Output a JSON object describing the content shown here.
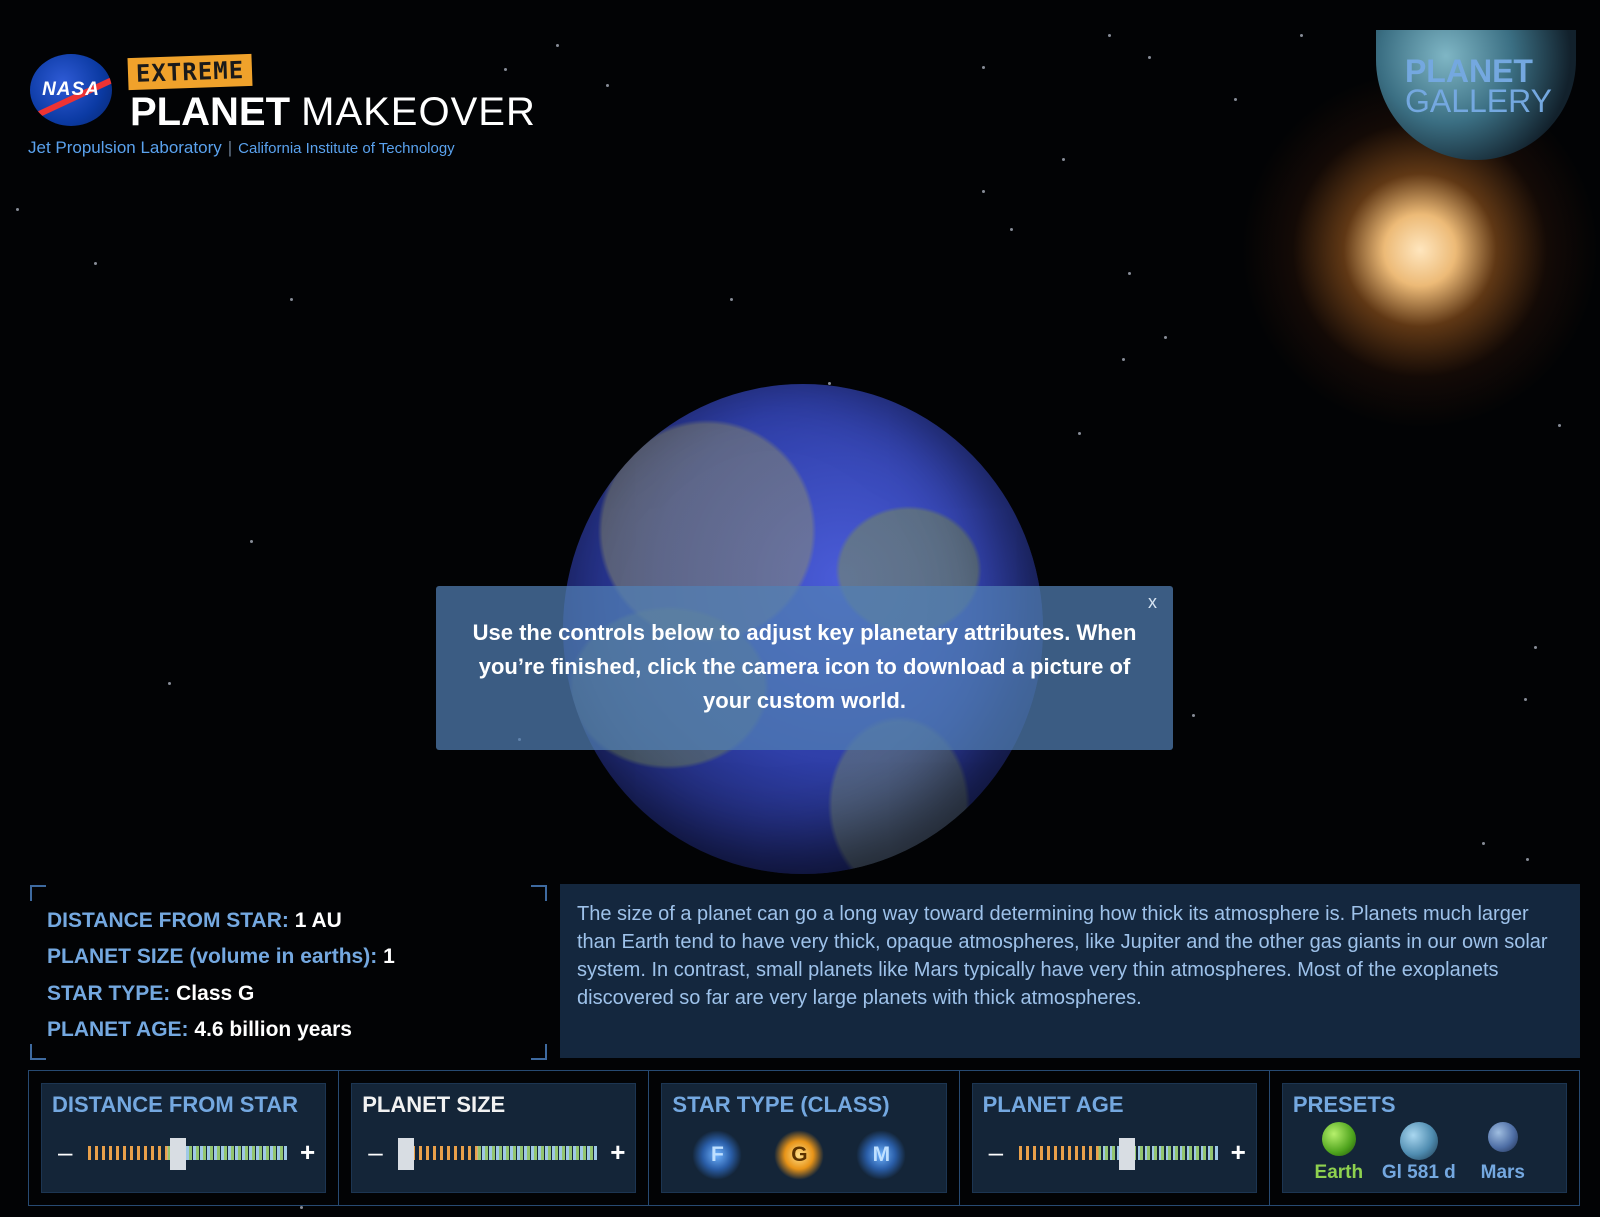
{
  "branding": {
    "nasa_logo_text": "NASA",
    "extreme_badge": "EXTREME",
    "title_bold": "PLANET",
    "title_light": "MAKEOVER",
    "org_jpl": "Jet Propulsion Laboratory",
    "org_caltech": "California Institute of Technology"
  },
  "gallery": {
    "line1": "PLANET",
    "line2": "GALLERY"
  },
  "tooltip": {
    "close_label": "x",
    "message": "Use the controls below to adjust key planetary attributes. When you’re finished, click the camera icon to download a picture of your custom world."
  },
  "stats": {
    "distance_label": "DISTANCE FROM STAR:",
    "distance_value": "1 AU",
    "size_label": "PLANET SIZE (volume in earths):",
    "size_value": "1",
    "star_type_label": "STAR TYPE:",
    "star_type_value": "Class G",
    "age_label": "PLANET AGE:",
    "age_value": "4.6 billion years"
  },
  "info_text": "The size of a planet can go a long way toward determining how thick its atmosphere is. Planets much larger than Earth tend to have very thick, opaque atmospheres, like Jupiter and the other gas giants in our own solar system. In contrast, small planets like Mars typically have very thin atmospheres. Most of the exoplanets discovered so far are very large planets with thick atmospheres.",
  "controls": {
    "distance": {
      "title": "DISTANCE FROM STAR",
      "minus": "–",
      "plus": "+",
      "level": 0.45
    },
    "size": {
      "title": "PLANET SIZE",
      "minus": "–",
      "plus": "+",
      "level": 0.0
    },
    "star_type": {
      "title": "STAR TYPE (CLASS)",
      "options": [
        "F",
        "G",
        "M"
      ],
      "selected": "G"
    },
    "age": {
      "title": "PLANET AGE",
      "minus": "–",
      "plus": "+",
      "level": 0.55
    },
    "presets": {
      "title": "PRESETS",
      "items": [
        "Earth",
        "Gl 581 d",
        "Mars"
      ],
      "selected": "Earth"
    }
  },
  "colors": {
    "accent_blue": "#74a8e0",
    "preset_selected": "#8fd14f",
    "star_g": "#e89418"
  }
}
